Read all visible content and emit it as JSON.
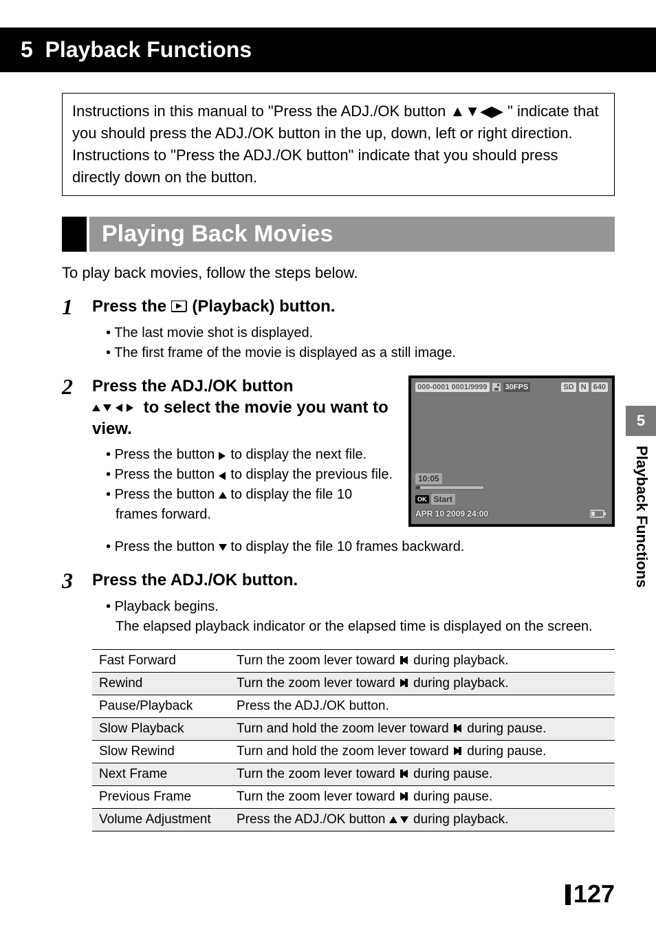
{
  "chapter": {
    "number": "5",
    "title": "Playback Functions"
  },
  "instruction_box": "Instructions in this manual to \"Press the ADJ./OK button ▲▼◀▶ \" indicate that you should press the ADJ./OK button in the up, down, left or right direction. Instructions to \"Press the ADJ./OK button\" indicate that you should press directly down on the button.",
  "section_heading": "Playing Back Movies",
  "intro_line": "To play back movies, follow the steps below.",
  "steps": {
    "s1": {
      "num": "1",
      "title_pre": "Press the ",
      "title_post": " (Playback) button.",
      "bullets": [
        "The last movie shot is displayed.",
        "The first frame of the movie is displayed as a still image."
      ]
    },
    "s2": {
      "num": "2",
      "title_line1": "Press the ADJ./OK button",
      "title_line2_post": " to select the movie you want to view.",
      "bullets": {
        "b1_pre": "Press the button ",
        "b1_post": " to display the next file.",
        "b2_pre": "Press the button ",
        "b2_post": " to display the previous file.",
        "b3_pre": "Press the button ",
        "b3_post": " to display the file 10 frames forward.",
        "b4_pre": "Press the button ",
        "b4_post": " to display the file 10 frames backward."
      }
    },
    "s3": {
      "num": "3",
      "title": "Press the ADJ./OK button.",
      "bullet": "Playback begins.",
      "note": "The elapsed playback indicator or the elapsed time is displayed on the screen."
    }
  },
  "lcd": {
    "file_counter": "000-0001 0001/9999",
    "fps": "30FPS",
    "sd": "SD",
    "quality": "N",
    "size": "640",
    "time": "10:05",
    "ok": "OK",
    "start": "Start",
    "date": "APR 10 2009 24:00"
  },
  "controls_table": [
    {
      "label": "Fast Forward",
      "desc_pre": "Turn the zoom lever toward ",
      "icon": "tele",
      "desc_post": " during playback."
    },
    {
      "label": "Rewind",
      "desc_pre": "Turn the zoom lever toward ",
      "icon": "wide",
      "desc_post": " during playback."
    },
    {
      "label": "Pause/Playback",
      "desc_pre": "Press the ADJ./OK button.",
      "icon": "",
      "desc_post": ""
    },
    {
      "label": "Slow Playback",
      "desc_pre": "Turn and hold the zoom lever toward ",
      "icon": "tele",
      "desc_post": " during pause."
    },
    {
      "label": "Slow Rewind",
      "desc_pre": "Turn and hold the zoom lever toward ",
      "icon": "wide",
      "desc_post": " during pause."
    },
    {
      "label": "Next Frame",
      "desc_pre": "Turn the zoom lever toward ",
      "icon": "tele",
      "desc_post": " during pause."
    },
    {
      "label": "Previous Frame",
      "desc_pre": "Turn the zoom lever toward ",
      "icon": "wide",
      "desc_post": " during pause."
    },
    {
      "label": "Volume Adjustment",
      "desc_pre": "Press the ADJ./OK button ",
      "icon": "updown",
      "desc_post": " during playback."
    }
  ],
  "side_tab": {
    "num": "5",
    "label": "Playback Functions"
  },
  "page_number": "127"
}
